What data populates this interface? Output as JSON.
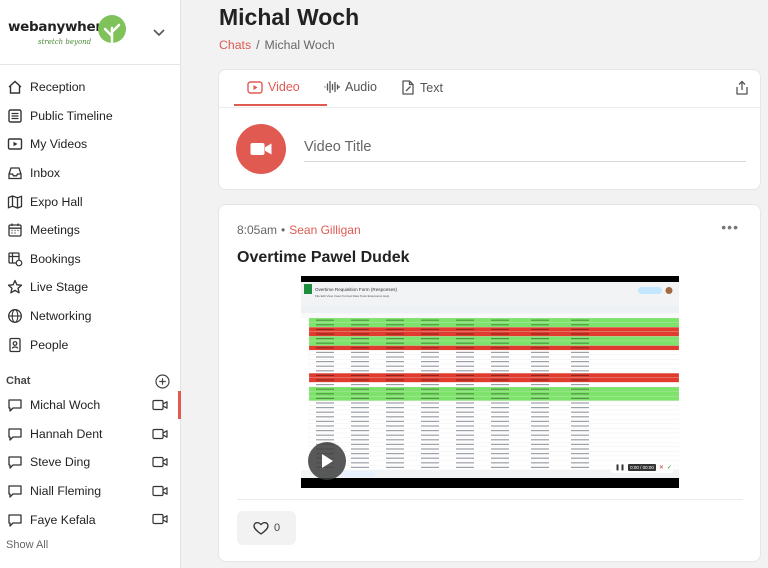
{
  "brand": {
    "name": "webanywhere",
    "tagline": "stretch beyond"
  },
  "sidebar": {
    "nav": [
      {
        "label": "Reception",
        "icon": "home-icon"
      },
      {
        "label": "Public Timeline",
        "icon": "timeline-icon"
      },
      {
        "label": "My Videos",
        "icon": "video-list-icon"
      },
      {
        "label": "Inbox",
        "icon": "inbox-icon"
      },
      {
        "label": "Expo Hall",
        "icon": "map-icon"
      },
      {
        "label": "Meetings",
        "icon": "calendar-icon"
      },
      {
        "label": "Bookings",
        "icon": "bookings-icon"
      },
      {
        "label": "Live Stage",
        "icon": "star-icon"
      },
      {
        "label": "Networking",
        "icon": "globe-icon"
      },
      {
        "label": "People",
        "icon": "badge-icon"
      }
    ],
    "chat_label": "Chat",
    "chats": [
      {
        "name": "Michal Woch",
        "active": true
      },
      {
        "name": "Hannah Dent",
        "active": false
      },
      {
        "name": "Steve Ding",
        "active": false
      },
      {
        "name": "Niall Fleming",
        "active": false
      },
      {
        "name": "Faye Kefala",
        "active": false
      }
    ],
    "show_all": "Show All"
  },
  "header": {
    "title": "Michal Woch",
    "breadcrumb": {
      "link": "Chats",
      "separator": "/",
      "current": "Michal Woch"
    }
  },
  "composer": {
    "tabs": [
      {
        "label": "Video",
        "active": true
      },
      {
        "label": "Audio",
        "active": false
      },
      {
        "label": "Text",
        "active": false
      }
    ],
    "title_placeholder": "Video Title"
  },
  "post": {
    "time": "8:05am",
    "separator": "•",
    "author": "Sean Gilligan",
    "title": "Overtime Pawel Dudek",
    "video": {
      "sheet_title": "Overtime Requisition Form (Responses)",
      "player_time": "0:00 / 00:00"
    },
    "likes": "0"
  },
  "colors": {
    "accent": "#e05a52",
    "brand_green": "#4a8a3a"
  }
}
